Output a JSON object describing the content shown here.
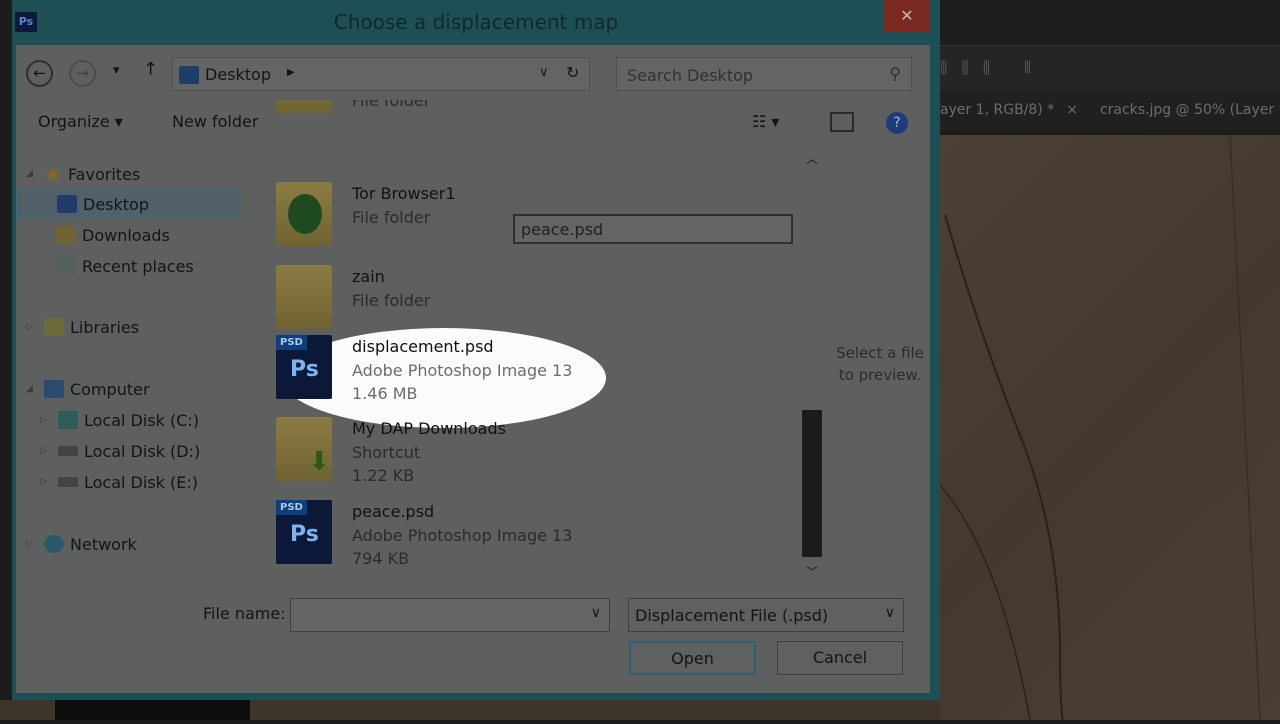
{
  "window": {
    "title": "Choose a displacement map",
    "app_icon": "Ps",
    "close": "✕"
  },
  "nav": {
    "back": "←",
    "forward": "→",
    "recent": "▾",
    "up": "↑",
    "location": "Desktop",
    "search_placeholder": "Search Desktop"
  },
  "toolbar": {
    "organize": "Organize ▾",
    "new_folder": "New folder"
  },
  "sidebar": {
    "favorites": "Favorites",
    "desktop": "Desktop",
    "downloads": "Downloads",
    "recent": "Recent places",
    "libraries": "Libraries",
    "computer": "Computer",
    "disk_c": "Local Disk (C:)",
    "disk_d": "Local Disk (D:)",
    "disk_e": "Local Disk (E:)",
    "network": "Network"
  },
  "files": [
    {
      "name": "",
      "type": "File folder"
    },
    {
      "name": "Tor Browser1",
      "type": "File folder"
    },
    {
      "name": "zain",
      "type": "File folder"
    },
    {
      "name": "displacement.psd",
      "type": "Adobe Photoshop Image 13",
      "size": "1.46 MB"
    },
    {
      "name": "My DAP Downloads",
      "type": "Shortcut",
      "size": "1.22 KB"
    },
    {
      "name": "peace.psd",
      "type": "Adobe Photoshop Image 13",
      "size": "794 KB"
    }
  ],
  "psd_badge": "PSD",
  "ps_text": "Ps",
  "rename_box": "peace.psd",
  "preview": "Select a file to preview.",
  "footer": {
    "file_name_label": "File name:",
    "file_name_value": "",
    "file_type": "Displacement File (.psd)",
    "open": "Open",
    "cancel": "Cancel"
  },
  "photoshop": {
    "tab1": "ayer 1, RGB/8) *",
    "tab_close": "×",
    "tab2": "cracks.jpg @ 50% (Layer"
  },
  "colors": {
    "title_bar": "#1e4f55",
    "highlight": "#fbfbfb",
    "close": "#7a2a22"
  }
}
